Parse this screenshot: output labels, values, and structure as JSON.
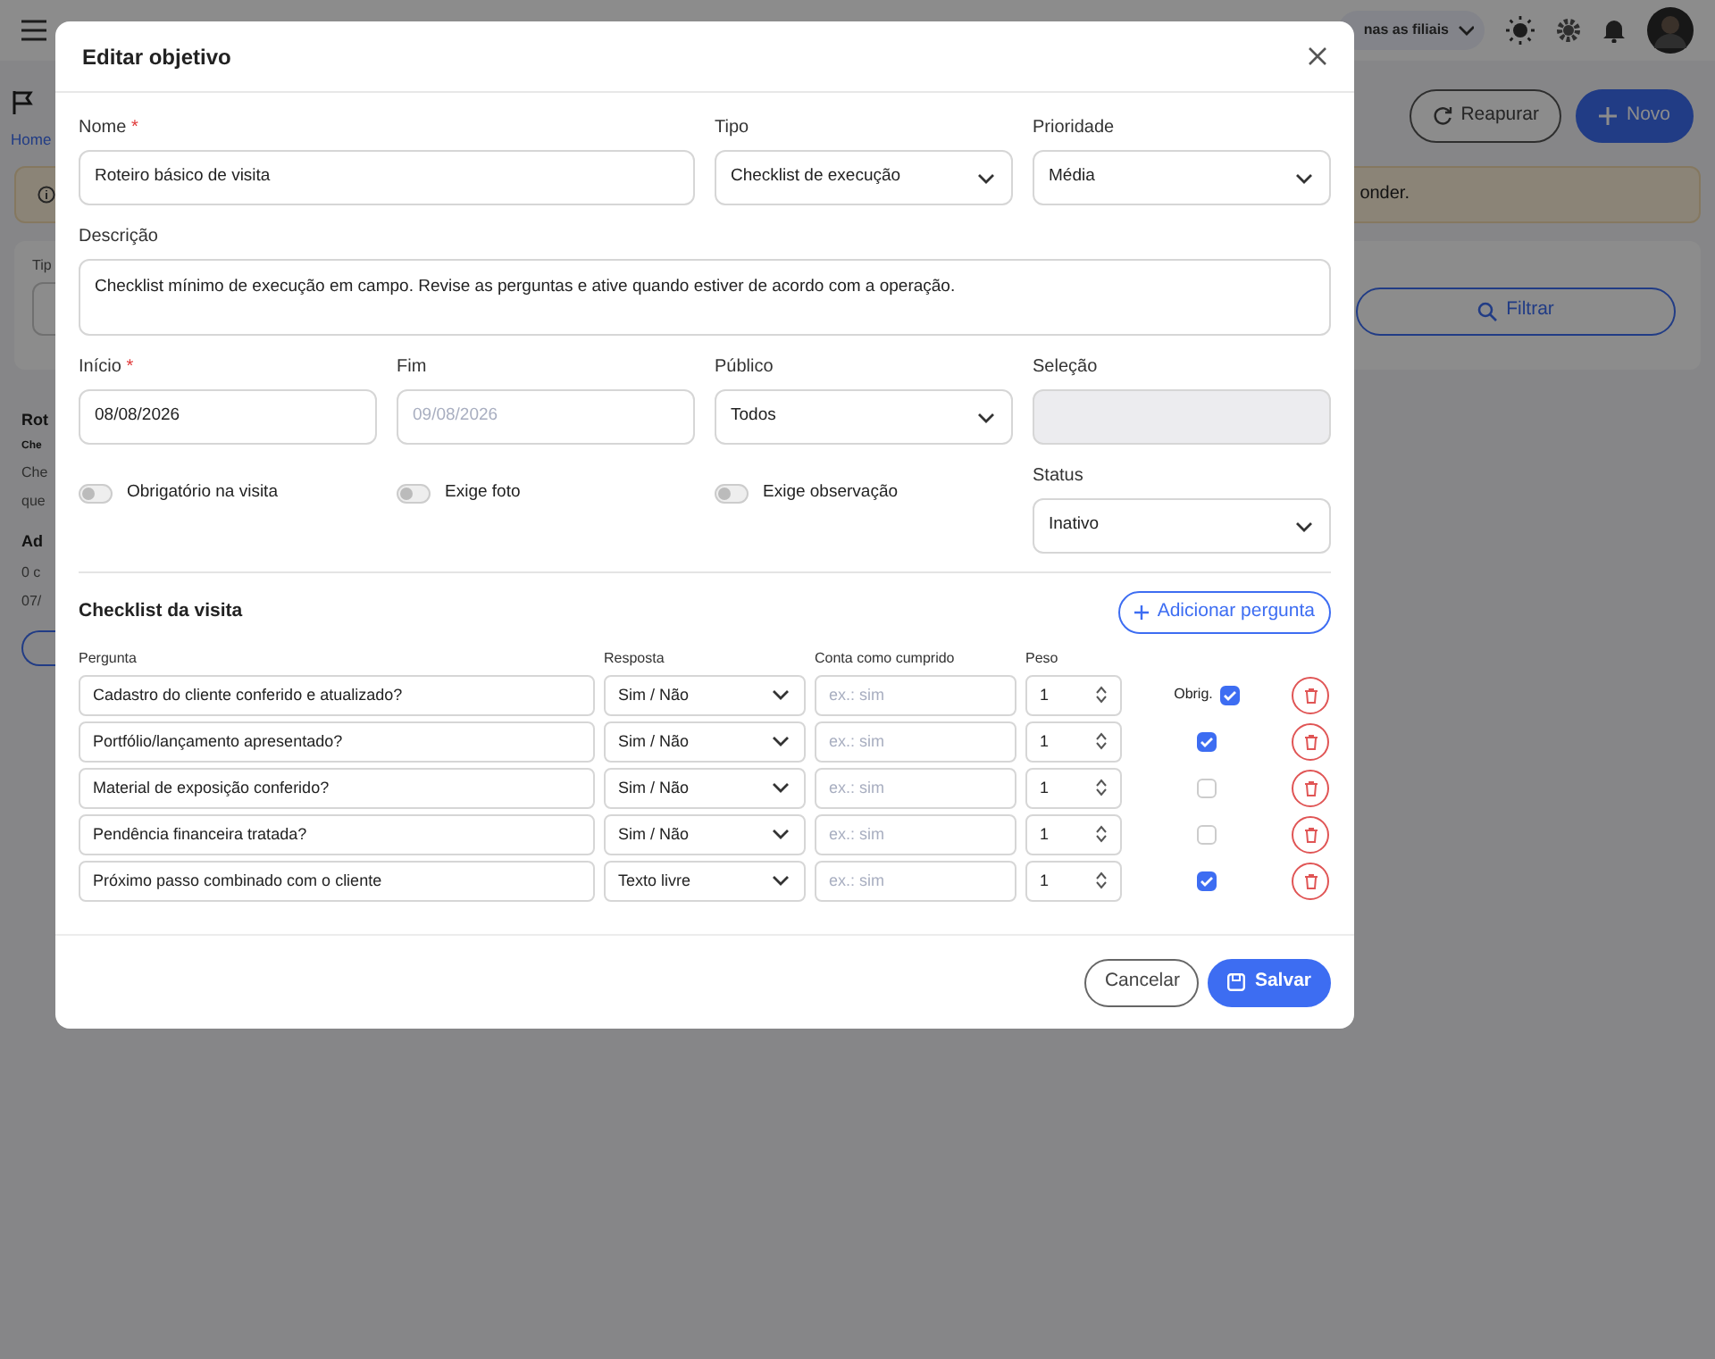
{
  "background": {
    "topbar": {
      "branch_selector": "nas as filiais"
    },
    "header": {
      "breadcrumb": "Home",
      "buttons": [
        {
          "label": "Reapurar",
          "kind": "outline"
        },
        {
          "label": "Novo",
          "kind": "primary"
        }
      ]
    },
    "alert": {
      "text": "onder."
    },
    "filter": {
      "label": "Tip",
      "button": "Filtrar"
    },
    "fragments": [
      {
        "text": "Rot",
        "kind": "title"
      },
      {
        "text": "Che",
        "kind": "tag"
      },
      {
        "text": "Che",
        "kind": "text"
      },
      {
        "text": "que",
        "kind": "text"
      },
      {
        "text": "Ad",
        "kind": "title"
      },
      {
        "text": "0 c",
        "kind": "text"
      },
      {
        "text": "07/",
        "kind": "text"
      }
    ]
  },
  "modal": {
    "title": "Editar objetivo",
    "fields": [
      {
        "kind": "wide_text",
        "label": "Nome",
        "required_mark": "*",
        "value": "Roteiro básico de visita"
      },
      {
        "kind": "select",
        "label": "Tipo",
        "value": "Checklist de execução"
      },
      {
        "kind": "select",
        "label": "Prioridade",
        "value": "Média"
      },
      {
        "kind": "textarea",
        "label": "Descrição",
        "value": "Checklist mínimo de execução em campo. Revise as perguntas e ative quando estiver de acordo com a operação."
      },
      {
        "kind": "text",
        "label": "Início",
        "required_mark": "*",
        "value": "08/08/2026"
      },
      {
        "kind": "text",
        "label": "Fim",
        "placeholder": "09/08/2026"
      },
      {
        "kind": "select",
        "label": "Público",
        "value": "Todos"
      },
      {
        "kind": "disabled",
        "label": "Seleção"
      },
      {
        "kind": "toggle",
        "label": "Obrigatório na visita",
        "on": false
      },
      {
        "kind": "toggle",
        "label": "Exige foto",
        "on": false
      },
      {
        "kind": "toggle",
        "label": "Exige observação",
        "on": false
      },
      {
        "kind": "select",
        "label": "Status",
        "value": "Inativo"
      }
    ],
    "checklist": {
      "title": "Checklist da visita",
      "add_button": "Adicionar pergunta",
      "columns": [
        "Pergunta",
        "Resposta",
        "Conta como cumprido",
        "Peso"
      ],
      "rows": [
        {
          "question": "Cadastro do cliente conferido e atualizado?",
          "answer": "Sim / Não",
          "counts_placeholder": "ex.: sim",
          "weight": "1",
          "required_label": "Obrig.",
          "checked": true
        },
        {
          "question": "Portfólio/lançamento apresentado?",
          "answer": "Sim / Não",
          "counts_placeholder": "ex.: sim",
          "weight": "1",
          "checked": true
        },
        {
          "question": "Material de exposição conferido?",
          "answer": "Sim / Não",
          "counts_placeholder": "ex.: sim",
          "weight": "1",
          "checked": false
        },
        {
          "question": "Pendência financeira tratada?",
          "answer": "Sim / Não",
          "counts_placeholder": "ex.: sim",
          "weight": "1",
          "checked": false
        },
        {
          "question": "Próximo passo combinado com o cliente",
          "answer": "Texto livre",
          "counts_placeholder": "ex.: sim",
          "weight": "1",
          "checked": true
        }
      ]
    },
    "buttons": [
      {
        "label": "Cancelar",
        "kind": "outline"
      },
      {
        "label": "Salvar",
        "kind": "primary"
      }
    ]
  }
}
